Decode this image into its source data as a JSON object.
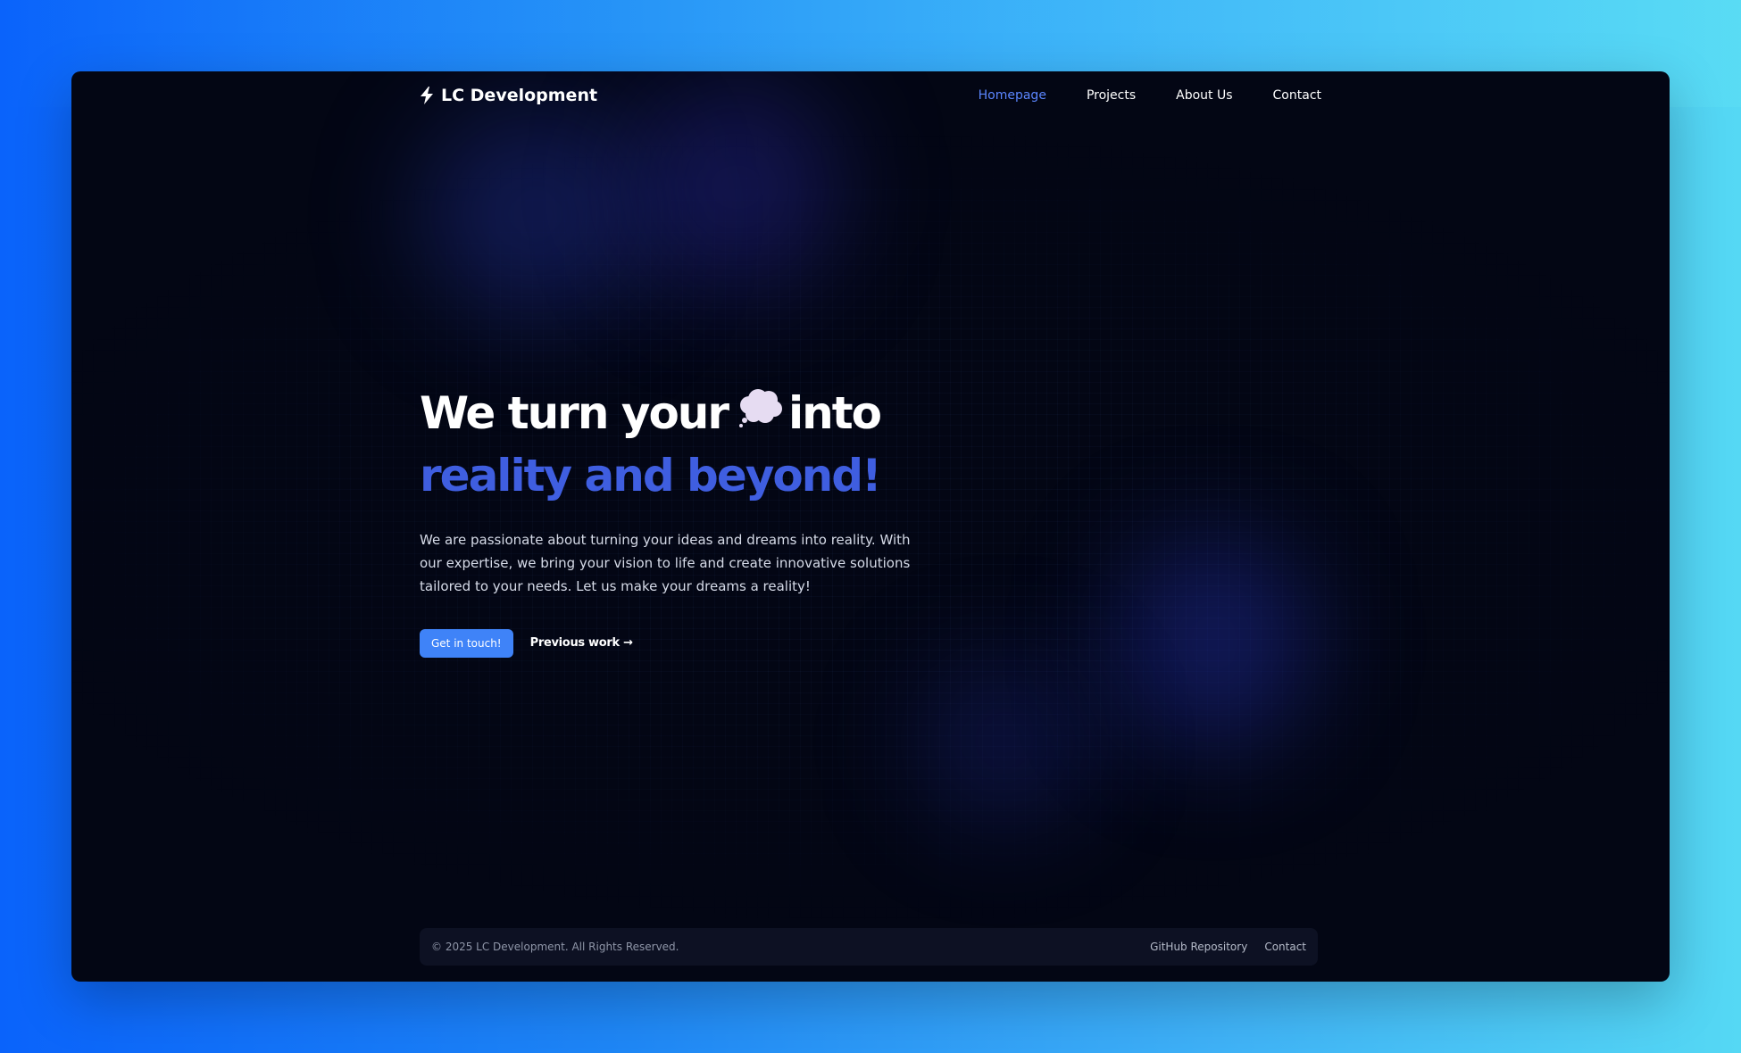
{
  "brand": {
    "icon": "lightning-bolt-icon",
    "name": "LC Development"
  },
  "nav": {
    "items": [
      {
        "label": "Homepage",
        "active": true
      },
      {
        "label": "Projects",
        "active": false
      },
      {
        "label": "About Us",
        "active": false
      },
      {
        "label": "Contact",
        "active": false
      }
    ]
  },
  "hero": {
    "headline_part1": "We turn your",
    "headline_icon": "thought-bubble-icon",
    "headline_part2": "into",
    "headline_accent": "reality and beyond!",
    "description": "We are passionate about turning your ideas and dreams into reality. With our expertise, we bring your vision to life and create innovative solutions tailored to your needs. Let us make your dreams a reality!",
    "primary_cta": "Get in touch!",
    "secondary_cta": "Previous work →"
  },
  "footer": {
    "copyright": "© 2025 LC Development. All Rights Reserved.",
    "links": [
      "GitHub Repository",
      "Contact"
    ]
  },
  "colors": {
    "background": "#030614",
    "accent": "#3f5ee0",
    "active_nav": "#5b86ff",
    "button": "#3f83f8"
  }
}
